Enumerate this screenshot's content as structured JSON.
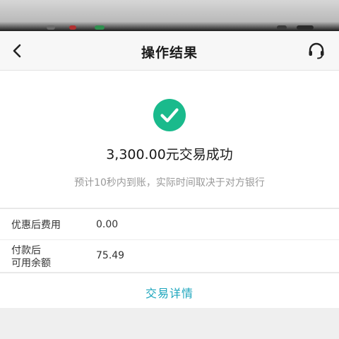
{
  "header": {
    "title": "操作结果"
  },
  "icons": {
    "back": "back-arrow-icon",
    "service": "customer-service-icon",
    "success": "check-circle-icon"
  },
  "colors": {
    "success_green": "#1aba8c",
    "link_blue": "#1ea6bd"
  },
  "result": {
    "amount_text": "3,300.00元交易成功",
    "note": "预计10秒内到账，实际时间取决于对方银行"
  },
  "info": {
    "rows": [
      {
        "label": "优惠后费用",
        "value": "0.00"
      },
      {
        "label": "付款后\n可用余额",
        "value": "75.49"
      }
    ]
  },
  "actions": {
    "details_label": "交易详情"
  }
}
